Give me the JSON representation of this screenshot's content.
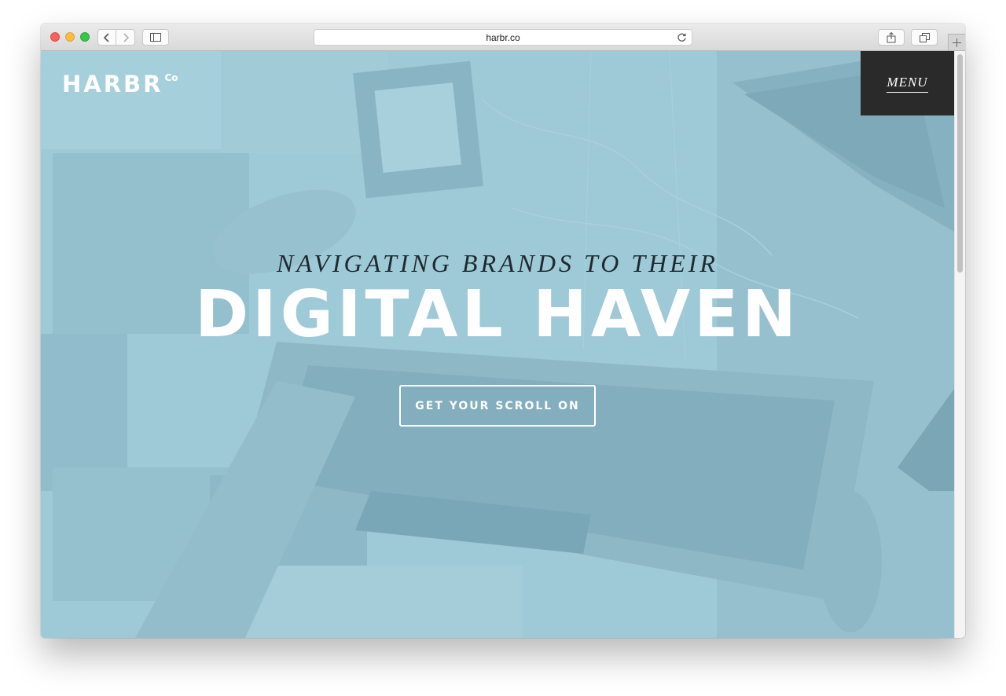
{
  "browser": {
    "url": "harbr.co"
  },
  "site": {
    "logo_text": "HARBR",
    "logo_mark": "Co",
    "menu_label": "MENU",
    "tagline": "NAVIGATING BRANDS TO THEIR",
    "headline": "DIGITAL HAVEN",
    "cta_label": "GET YOUR SCROLL ON"
  },
  "colors": {
    "overlay": "#9ec9d7",
    "menu_bg": "#2a2a2a",
    "headline": "#ffffff",
    "tagline": "#1f2a30"
  },
  "icons": {
    "back": "chevron-left-icon",
    "forward": "chevron-right-icon",
    "sidebar": "sidebar-icon",
    "reload": "reload-icon",
    "share": "share-icon",
    "tabs": "tabs-icon",
    "new_tab": "plus-icon"
  }
}
